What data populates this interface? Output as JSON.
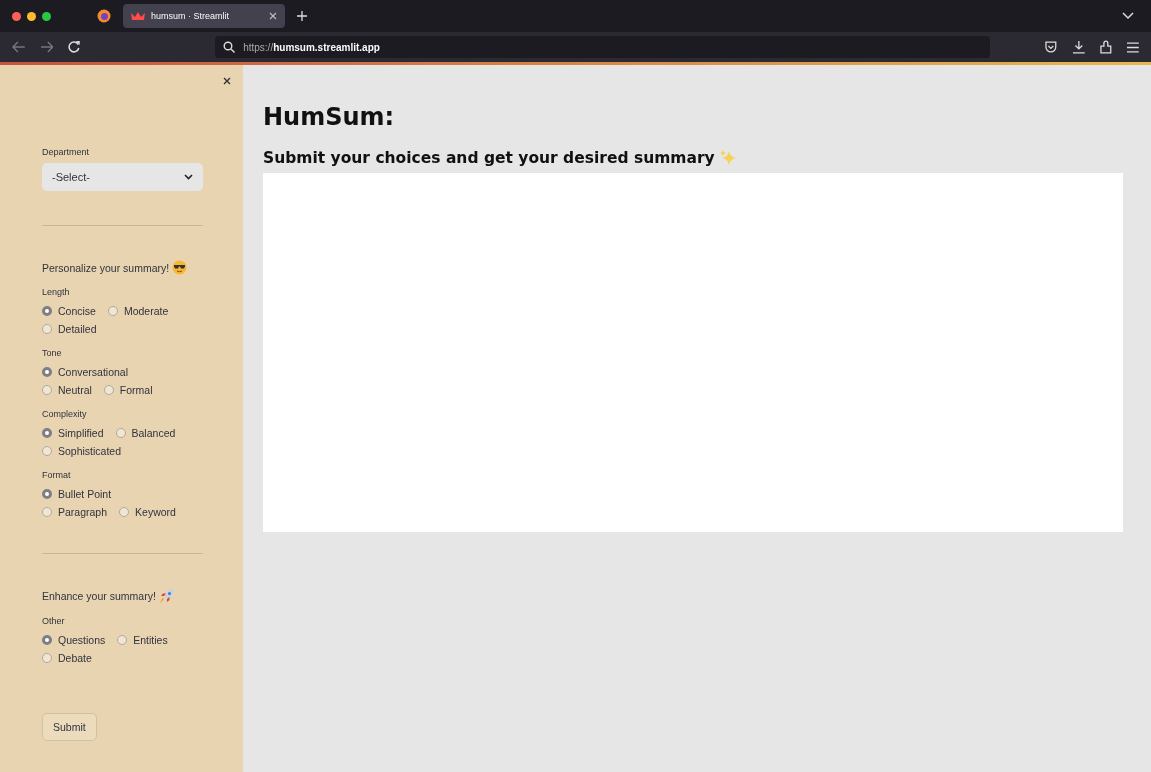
{
  "browser": {
    "tab": {
      "title": "humsum · Streamlit",
      "selected": true
    },
    "url_prefix": "https://",
    "url_host": "humsum.streamlit.app"
  },
  "sidebar": {
    "department": {
      "label": "Department",
      "value": "-Select-"
    },
    "sections": [
      {
        "heading": "Personalize your summary!",
        "groups": [
          {
            "label": "Length",
            "options": [
              {
                "label": "Concise",
                "selected": true
              },
              {
                "label": "Moderate",
                "selected": false
              },
              {
                "label": "Detailed",
                "selected": false
              }
            ]
          },
          {
            "label": "Tone",
            "options": [
              {
                "label": "Conversational",
                "selected": true
              },
              {
                "label": "Neutral",
                "selected": false
              },
              {
                "label": "Formal",
                "selected": false
              }
            ]
          },
          {
            "label": "Complexity",
            "options": [
              {
                "label": "Simplified",
                "selected": true
              },
              {
                "label": "Balanced",
                "selected": false
              },
              {
                "label": "Sophisticated",
                "selected": false
              }
            ]
          },
          {
            "label": "Format",
            "options": [
              {
                "label": "Bullet Point",
                "selected": true
              },
              {
                "label": "Paragraph",
                "selected": false
              },
              {
                "label": "Keyword",
                "selected": false
              }
            ]
          }
        ]
      },
      {
        "heading": "Enhance your summary!",
        "groups": [
          {
            "label": "Other",
            "options": [
              {
                "label": "Questions",
                "selected": true
              },
              {
                "label": "Entities",
                "selected": false
              },
              {
                "label": "Debate",
                "selected": false
              }
            ]
          }
        ]
      }
    ],
    "submit": "Submit"
  },
  "main": {
    "title": "HumSum:",
    "subtitle": "Submit your choices and get your desired summary"
  }
}
